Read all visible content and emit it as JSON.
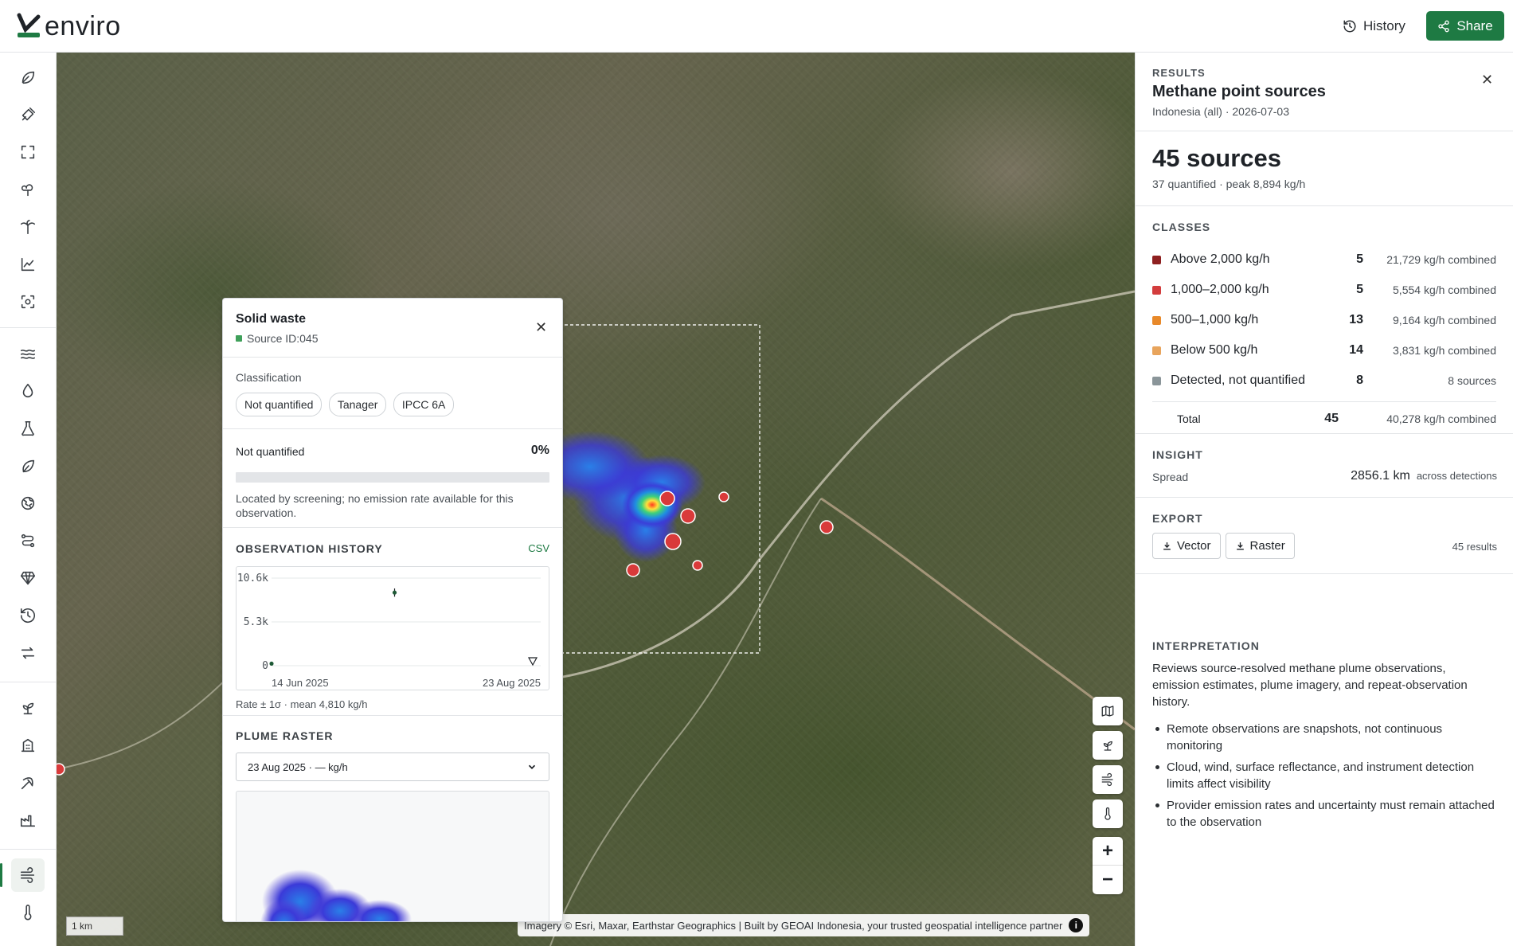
{
  "app": {
    "logo_text": "enviro",
    "history_label": "History",
    "share_label": "Share"
  },
  "map": {
    "scale_label": "1 km",
    "attribution": "Imagery © Esri, Maxar, Earthstar Geographics | Built by GEOAI Indonesia, your trusted geospatial intelligence partner",
    "info_label": "i",
    "zoom_in": "+",
    "zoom_out": "−"
  },
  "popup": {
    "title": "Solid waste",
    "source_id": "Source ID:045",
    "classification_label": "Classification",
    "chips": [
      "Not quantified",
      "Tanager",
      "IPCC 6A"
    ],
    "quant_label": "Not quantified",
    "quant_percent": "0%",
    "quant_fraction": 0,
    "quant_note": "Located by screening; no emission rate available for this observation.",
    "history_title": "OBSERVATION HISTORY",
    "csv_label": "CSV",
    "chart_caption": "Rate ± 1σ · mean 4,810 kg/h",
    "raster_title": "PLUME RASTER",
    "raster_select": "23 Aug 2025 · — kg/h"
  },
  "chart_data": {
    "type": "scatter",
    "y_ticks": [
      "10.6k",
      "5.3k",
      "0"
    ],
    "x_ticks": [
      "14 Jun 2025",
      "23 Aug 2025"
    ],
    "ylim": [
      0,
      10600
    ],
    "xlim": [
      "2025-06-14",
      "2025-08-23"
    ],
    "points": [
      {
        "x": "2025-06-14",
        "y": 250,
        "err": 150
      },
      {
        "x": "2025-07-16",
        "y": 8850,
        "err": 500
      }
    ],
    "not_quantified_x": "2025-08-23",
    "grid": true
  },
  "panel": {
    "results_label": "RESULTS",
    "title": "Methane point sources",
    "subtitle": "Indonesia (all) · 2026-07-03",
    "count": "45 sources",
    "count_sub": "37 quantified · peak 8,894 kg/h",
    "classes_label": "CLASSES",
    "classes": [
      {
        "name": "Above 2,000 kg/h",
        "count": "5",
        "combined": "21,729 kg/h combined",
        "color": "#8e2020"
      },
      {
        "name": "1,000–2,000 kg/h",
        "count": "5",
        "combined": "5,554 kg/h combined",
        "color": "#d33d3d"
      },
      {
        "name": "500–1,000 kg/h",
        "count": "13",
        "combined": "9,164 kg/h combined",
        "color": "#e8892a"
      },
      {
        "name": "Below 500 kg/h",
        "count": "14",
        "combined": "3,831 kg/h combined",
        "color": "#e8a45c"
      },
      {
        "name": "Detected, not quantified",
        "count": "8",
        "combined": "8 sources",
        "color": "#8a9599"
      }
    ],
    "total_label": "Total",
    "total_count": "45",
    "total_combined": "40,278 kg/h combined",
    "insight_label": "INSIGHT",
    "spread_label": "Spread",
    "spread_value": "2856.1 km",
    "spread_suffix": "across detections",
    "export_label": "EXPORT",
    "vector_label": "Vector",
    "raster_label": "Raster",
    "export_count": "45 results",
    "interp_label": "INTERPRETATION",
    "interp_text": "Reviews source-resolved methane plume observations, emission estimates, plume imagery, and repeat-observation history.",
    "bullets": [
      "Remote observations are snapshots, not continuous monitoring",
      "Cloud, wind, surface reflectance, and instrument detection limits affect visibility",
      "Provider emission rates and uncertainty must remain attached to the observation"
    ]
  },
  "colors": {
    "accent": "#1e7a43"
  }
}
